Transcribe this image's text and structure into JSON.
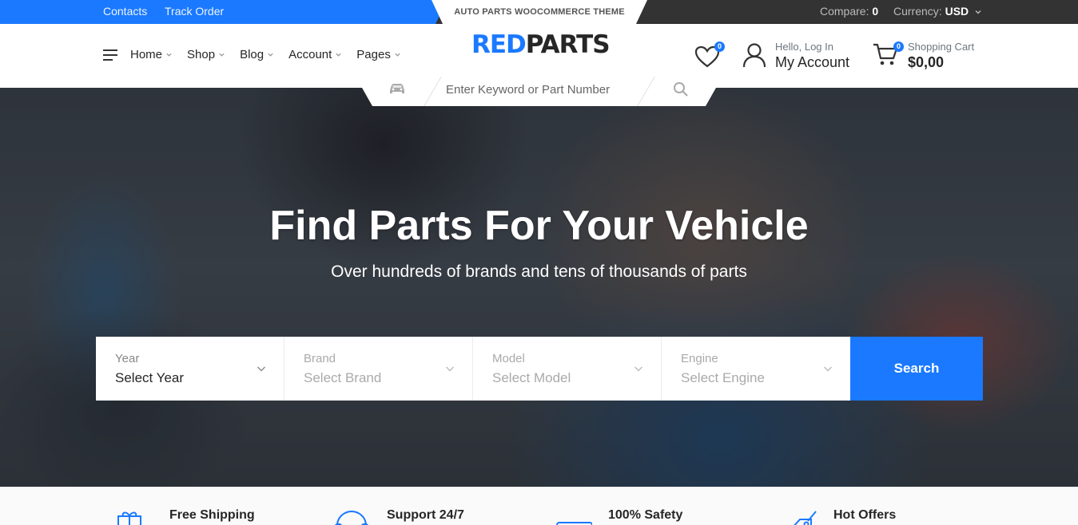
{
  "topbar": {
    "links": [
      "Contacts",
      "Track Order"
    ],
    "compare_label": "Compare:",
    "compare_value": "0",
    "currency_label": "Currency:",
    "currency_value": "USD"
  },
  "header": {
    "tagline": "AUTO PARTS WOOCOMMERCE THEME",
    "logo_part1": "RED",
    "logo_part2": "PARTS",
    "nav": [
      "Home",
      "Shop",
      "Blog",
      "Account",
      "Pages"
    ],
    "wishlist_count": "0",
    "account_small": "Hello, Log In",
    "account_big": "My Account",
    "cart_count": "0",
    "cart_small": "Shopping Cart",
    "cart_big": "$0,00"
  },
  "search": {
    "placeholder": "Enter Keyword or Part Number"
  },
  "hero": {
    "title": "Find Parts For Your Vehicle",
    "subtitle": "Over hundreds of brands and tens of thousands of parts",
    "fields": [
      {
        "label": "Year",
        "value": "Select Year"
      },
      {
        "label": "Brand",
        "value": "Select Brand"
      },
      {
        "label": "Model",
        "value": "Select Model"
      },
      {
        "label": "Engine",
        "value": "Select Engine"
      }
    ],
    "button": "Search"
  },
  "features": [
    {
      "title": "Free Shipping",
      "icon": "free-shipping-icon"
    },
    {
      "title": "Support 24/7",
      "icon": "support-icon"
    },
    {
      "title": "100% Safety",
      "icon": "safety-icon"
    },
    {
      "title": "Hot Offers",
      "icon": "offers-icon"
    }
  ],
  "colors": {
    "accent": "#1a79ff",
    "topbar": "#333333",
    "text": "#262626"
  }
}
